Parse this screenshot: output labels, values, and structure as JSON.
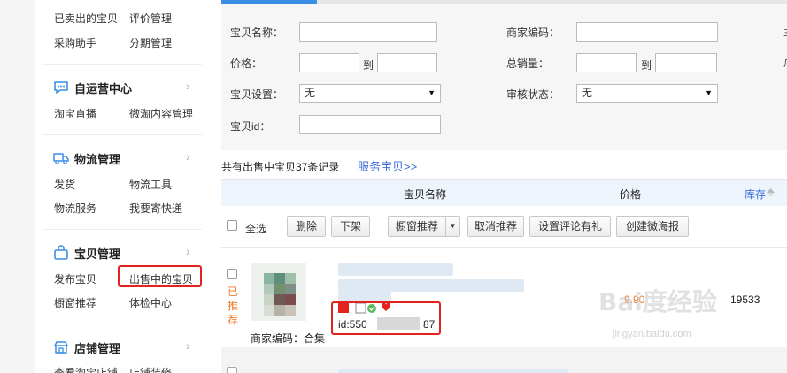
{
  "sidebar": {
    "top_links": [
      "已卖出的宝贝",
      "评价管理",
      "采购助手",
      "分期管理"
    ],
    "sections": [
      {
        "title": "自运营中心",
        "icon": "chat-icon",
        "links": [
          "淘宝直播",
          "微淘内容管理"
        ]
      },
      {
        "title": "物流管理",
        "icon": "truck-icon",
        "links": [
          "发货",
          "物流工具",
          "物流服务",
          "我要寄快递"
        ]
      },
      {
        "title": "宝贝管理",
        "icon": "bag-icon",
        "links": [
          "发布宝贝",
          "出售中的宝贝",
          "橱窗推荐",
          "体检中心"
        ]
      },
      {
        "title": "店铺管理",
        "icon": "store-icon",
        "links": [
          "查看淘宝店铺",
          "店铺装修"
        ]
      }
    ],
    "chevron": "›"
  },
  "filters": {
    "name_label": "宝贝名称：",
    "merchant_code_label": "商家编码：",
    "price_label": "价格：",
    "to": "到",
    "total_sales_label": "总销量：",
    "setting_label": "宝贝设置：",
    "setting_value": "无",
    "audit_label": "审核状态：",
    "audit_value": "无",
    "id_label": "宝贝id：",
    "edge_char_1": "主",
    "edge_char_2": "爪"
  },
  "summary": {
    "text": "共有出售中宝贝37条记录",
    "service_link": "服务宝贝>>"
  },
  "table": {
    "col_name": "宝贝名称",
    "col_price": "价格",
    "col_stock": "库存"
  },
  "actions": {
    "select_all": "全选",
    "delete": "删除",
    "delist": "下架",
    "window_recommend": "橱窗推荐",
    "cancel_recommend": "取消推荐",
    "set_review_gift": "设置评论有礼",
    "create_poster": "创建微海报"
  },
  "item": {
    "status": "已推荐",
    "id_prefix": "id:550",
    "id_suffix": "87",
    "merchant_code": "商家编码：合集",
    "price": "9.90",
    "stock": "19533"
  },
  "watermark": {
    "main": "Bai度经验",
    "sub": "jingyan.baidu.com"
  },
  "colors": {
    "highlight": "#e3231c",
    "link": "#3a6fd8",
    "price": "#f07b26",
    "tab_active": "#3a8ee6"
  }
}
